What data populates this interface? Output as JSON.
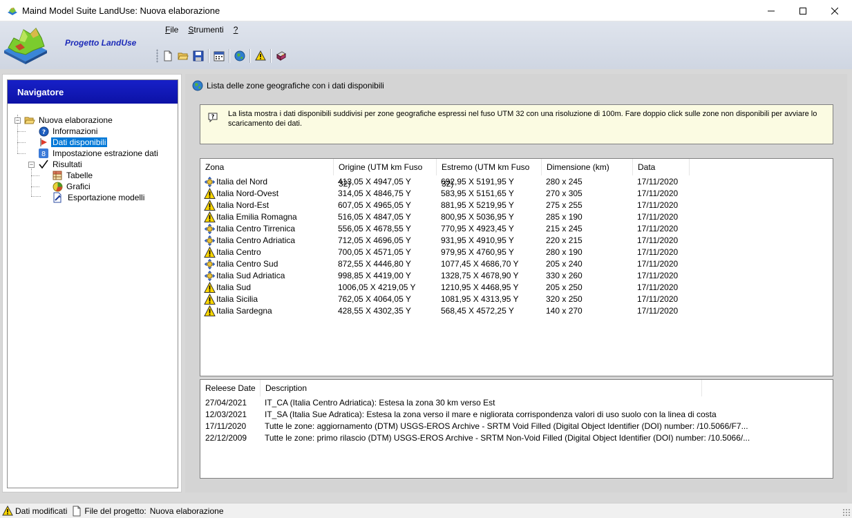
{
  "window": {
    "title": "Maind Model Suite LandUse: Nuova elaborazione"
  },
  "header": {
    "project_label": "Progetto LandUse",
    "menu": [
      {
        "label": "File",
        "accel": "F",
        "rest": "ile"
      },
      {
        "label": "Strumenti",
        "accel": "S",
        "rest": "trumenti"
      },
      {
        "label": "?",
        "accel": "?",
        "rest": ""
      }
    ],
    "toolbar_icons": [
      "new-document-icon",
      "open-folder-icon",
      "save-icon",
      "calendar-icon",
      "globe-icon",
      "warning-icon",
      "book-icon"
    ]
  },
  "navigator": {
    "title": "Navigatore",
    "tree": {
      "root": "Nuova elaborazione",
      "informazioni": "Informazioni",
      "dati_disponibili": "Dati disponibili",
      "impostazione": "Impostazione estrazione dati",
      "risultati": "Risultati",
      "tabelle": "Tabelle",
      "grafici": "Grafici",
      "esportazione": "Esportazione modelli"
    },
    "selected": "Dati disponibili"
  },
  "content": {
    "title": "Lista delle zone geografiche con i dati disponibili",
    "info": "La lista mostra i dati disponibili suddivisi per zone geografiche espressi nel fuso UTM 32 con una risoluzione di 100m. Fare doppio click sulle zone non disponibili per avviare lo scaricamento dei dati.",
    "zones_columns": {
      "zona": "Zona",
      "origine": "Origine (UTM km Fuso 32)",
      "estremo": "Estremo (UTM km Fuso 32)",
      "dimensione": "Dimensione (km)",
      "data": "Data"
    },
    "zones": [
      {
        "status": "available",
        "zona": "Italia del Nord",
        "origine": "413,05 X 4947,05 Y",
        "estremo": "692,95 X 5191,95 Y",
        "dimensione": "280 x 245",
        "data": "17/11/2020"
      },
      {
        "status": "missing",
        "zona": "Italia Nord-Ovest",
        "origine": "314,05 X 4846,75 Y",
        "estremo": "583,95 X 5151,65 Y",
        "dimensione": "270 x 305",
        "data": "17/11/2020"
      },
      {
        "status": "missing",
        "zona": "Italia Nord-Est",
        "origine": "607,05 X 4965,05 Y",
        "estremo": "881,95 X 5219,95 Y",
        "dimensione": "275 x 255",
        "data": "17/11/2020"
      },
      {
        "status": "missing",
        "zona": "Italia Emilia Romagna",
        "origine": "516,05 X 4847,05 Y",
        "estremo": "800,95 X 5036,95 Y",
        "dimensione": "285 x 190",
        "data": "17/11/2020"
      },
      {
        "status": "available",
        "zona": "Italia Centro Tirrenica",
        "origine": "556,05 X 4678,55 Y",
        "estremo": "770,95 X 4923,45 Y",
        "dimensione": "215 x 245",
        "data": "17/11/2020"
      },
      {
        "status": "available",
        "zona": "Italia Centro Adriatica",
        "origine": "712,05 X 4696,05 Y",
        "estremo": "931,95 X 4910,95 Y",
        "dimensione": "220 x 215",
        "data": "17/11/2020"
      },
      {
        "status": "missing",
        "zona": "Italia Centro",
        "origine": "700,05 X 4571,05 Y",
        "estremo": "979,95 X 4760,95 Y",
        "dimensione": "280 x 190",
        "data": "17/11/2020"
      },
      {
        "status": "available",
        "zona": "Italia Centro Sud",
        "origine": "872,55 X 4446,80 Y",
        "estremo": "1077,45 X 4686,70 Y",
        "dimensione": "205 x 240",
        "data": "17/11/2020"
      },
      {
        "status": "available",
        "zona": "Italia Sud Adriatica",
        "origine": "998,85 X 4419,00 Y",
        "estremo": "1328,75 X 4678,90 Y",
        "dimensione": "330 x 260",
        "data": "17/11/2020"
      },
      {
        "status": "missing",
        "zona": "Italia Sud",
        "origine": "1006,05 X 4219,05 Y",
        "estremo": "1210,95 X 4468,95 Y",
        "dimensione": "205 x 250",
        "data": "17/11/2020"
      },
      {
        "status": "missing",
        "zona": "Italia Sicilia",
        "origine": "762,05 X 4064,05 Y",
        "estremo": "1081,95 X 4313,95 Y",
        "dimensione": "320 x 250",
        "data": "17/11/2020"
      },
      {
        "status": "missing",
        "zona": "Italia Sardegna",
        "origine": "428,55 X 4302,35 Y",
        "estremo": "568,45 X 4572,25 Y",
        "dimensione": "140 x 270",
        "data": "17/11/2020"
      }
    ],
    "release_columns": {
      "date": "Releese Date",
      "description": "Description"
    },
    "releases": [
      {
        "date": "27/04/2021",
        "description": "IT_CA (Italia Centro Adriatica): Estesa la zona 30 km verso Est"
      },
      {
        "date": "12/03/2021",
        "description": "IT_SA (Italia Sue Adratica): Estesa la zona verso il mare e nigliorata corrispondenza valori di uso suolo con la linea di costa"
      },
      {
        "date": "17/11/2020",
        "description": "Tutte le zone: aggiornamento (DTM) USGS-EROS Archive - SRTM Void Filled (Digital Object Identifier (DOI) number: /10.5066/F7..."
      },
      {
        "date": "22/12/2009",
        "description": "Tutte le zone: primo rilascio (DTM) USGS-EROS Archive - SRTM Non-Void Filled (Digital Object Identifier (DOI) number: /10.5066/..."
      }
    ]
  },
  "statusbar": {
    "modified": "Dati modificati",
    "project_file_label": "File del progetto:",
    "project_file_name": "Nuova elaborazione"
  },
  "colors": {
    "navigator_header": "#1720c8",
    "selection": "#0078d7",
    "info_background": "#fbfbe2",
    "warning_yellow": "#ffd800"
  }
}
